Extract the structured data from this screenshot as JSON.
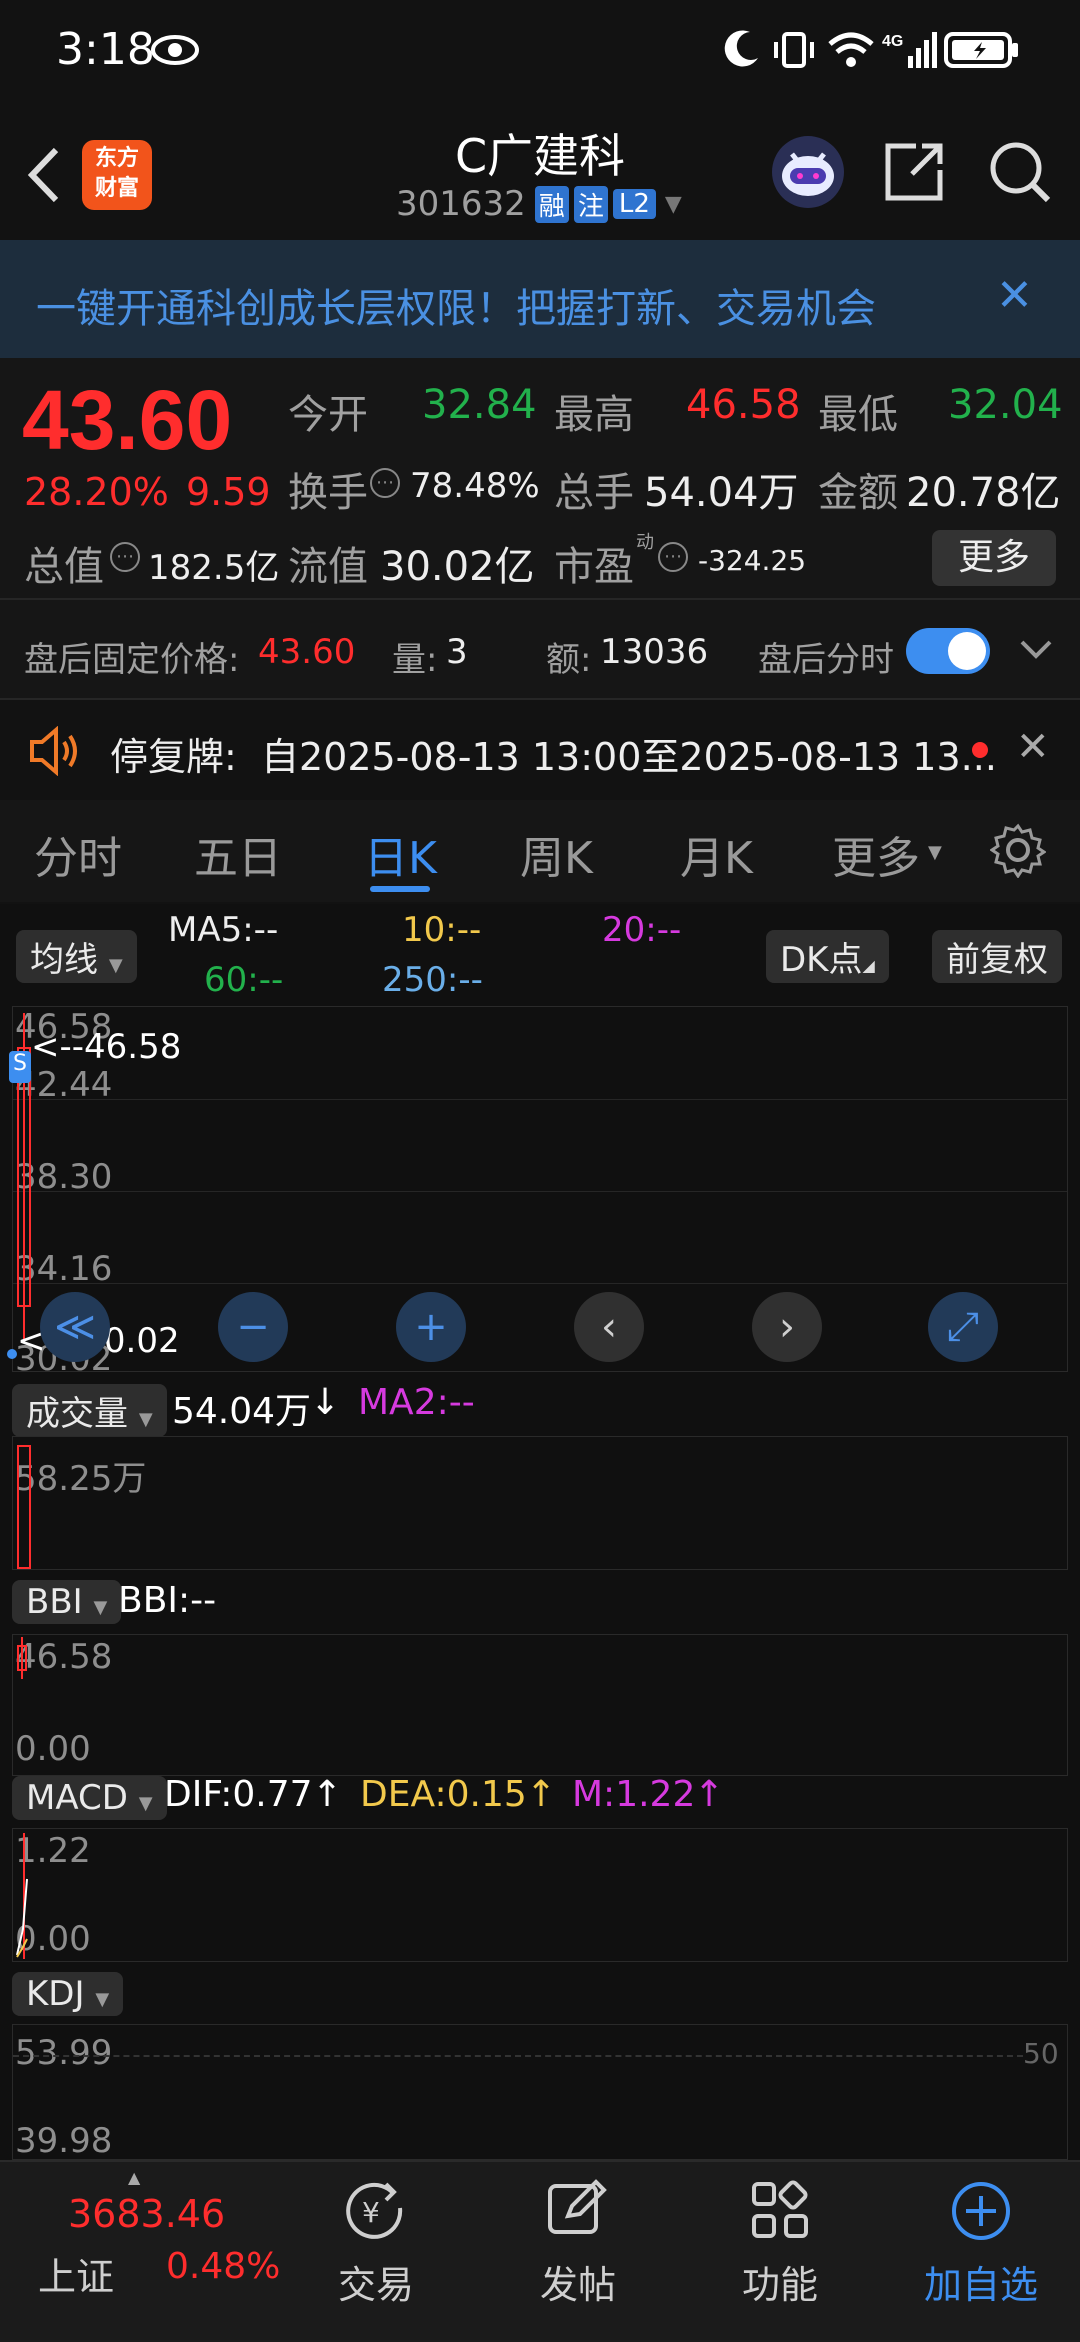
{
  "status": {
    "time": "3:18"
  },
  "header": {
    "back": "<",
    "logo_line1": "东方",
    "logo_line2": "财富",
    "title": "C广建科",
    "code": "301632",
    "badges": [
      "融",
      "注",
      "L2"
    ]
  },
  "banner": {
    "text": "一键开通科创成长层权限！把握打新、交易机会",
    "close": "✕"
  },
  "quote": {
    "price": "43.60",
    "pct": "28.20%",
    "chg": "9.59",
    "open_label": "今开",
    "open": "32.84",
    "high_label": "最高",
    "high": "46.58",
    "low_label": "最低",
    "low": "32.04",
    "turnover_label": "换手",
    "turnover": "78.48%",
    "vol_label": "总手",
    "vol": "54.04万",
    "amt_label": "金额",
    "amt": "20.78亿",
    "mktcap_label": "总值",
    "mktcap": "182.5亿",
    "float_label": "流值",
    "float": "30.02亿",
    "pe_label": "市盈",
    "pe_sup": "动",
    "pe": "-324.25",
    "more": "更多"
  },
  "after": {
    "price_label": "盘后固定价格:",
    "price": "43.60",
    "qty_label": "量:",
    "qty": "3",
    "amt_label": "额:",
    "amt": "13036",
    "timeshare_label": "盘后分时"
  },
  "notice": {
    "text": "停复牌:  自2025-08-13 13:00至2025-08-13 13...",
    "close": "✕"
  },
  "tabs": [
    "分时",
    "五日",
    "日K",
    "周K",
    "月K",
    "更多"
  ],
  "ma": {
    "chip": "均线",
    "ma5": "MA5:--",
    "ma10": "10:--",
    "ma20": "20:--",
    "ma60": "60:--",
    "ma250": "250:--",
    "dk": "DK点",
    "adjust": "前复权"
  },
  "kline": {
    "axis": [
      "46.58",
      "42.44",
      "38.30",
      "34.16",
      "30.02"
    ],
    "high_marker": "<--46.58",
    "low_marker": "<---30.02",
    "s_badge": "S"
  },
  "nav_controls": [
    "≪",
    "−",
    "+",
    "‹",
    "›",
    "⤢"
  ],
  "volume": {
    "chip": "成交量",
    "value": "54.04万",
    "arrow": "↓",
    "ma2": "MA2:--",
    "axis": "58.25万"
  },
  "bbi": {
    "chip": "BBI",
    "value": "BBI:--",
    "axis_top": "46.58",
    "axis_bottom": "0.00"
  },
  "macd": {
    "chip": "MACD",
    "dif": "DIF:0.77",
    "dea": "DEA:0.15",
    "m": "M:1.22",
    "up": "↑",
    "axis_top": "1.22",
    "axis_bottom": "0.00"
  },
  "kdj": {
    "chip": "KDJ",
    "axis_top": "53.99",
    "axis_bottom": "39.98",
    "right_label": "50"
  },
  "bottom_nav": {
    "index_value": "3683.46",
    "index_name": "上证",
    "index_pct": "0.48%",
    "trade": "交易",
    "post": "发帖",
    "func": "功能",
    "watch": "加自选"
  },
  "colors": {
    "up": "#ff2d2d",
    "down": "#22b14c",
    "accent": "#3d8ef0",
    "banner_text": "#4a90e2",
    "ma10": "#f2c94c",
    "ma20": "#d63adf",
    "ma60": "#22b14c",
    "ma250": "#6aaee8"
  }
}
